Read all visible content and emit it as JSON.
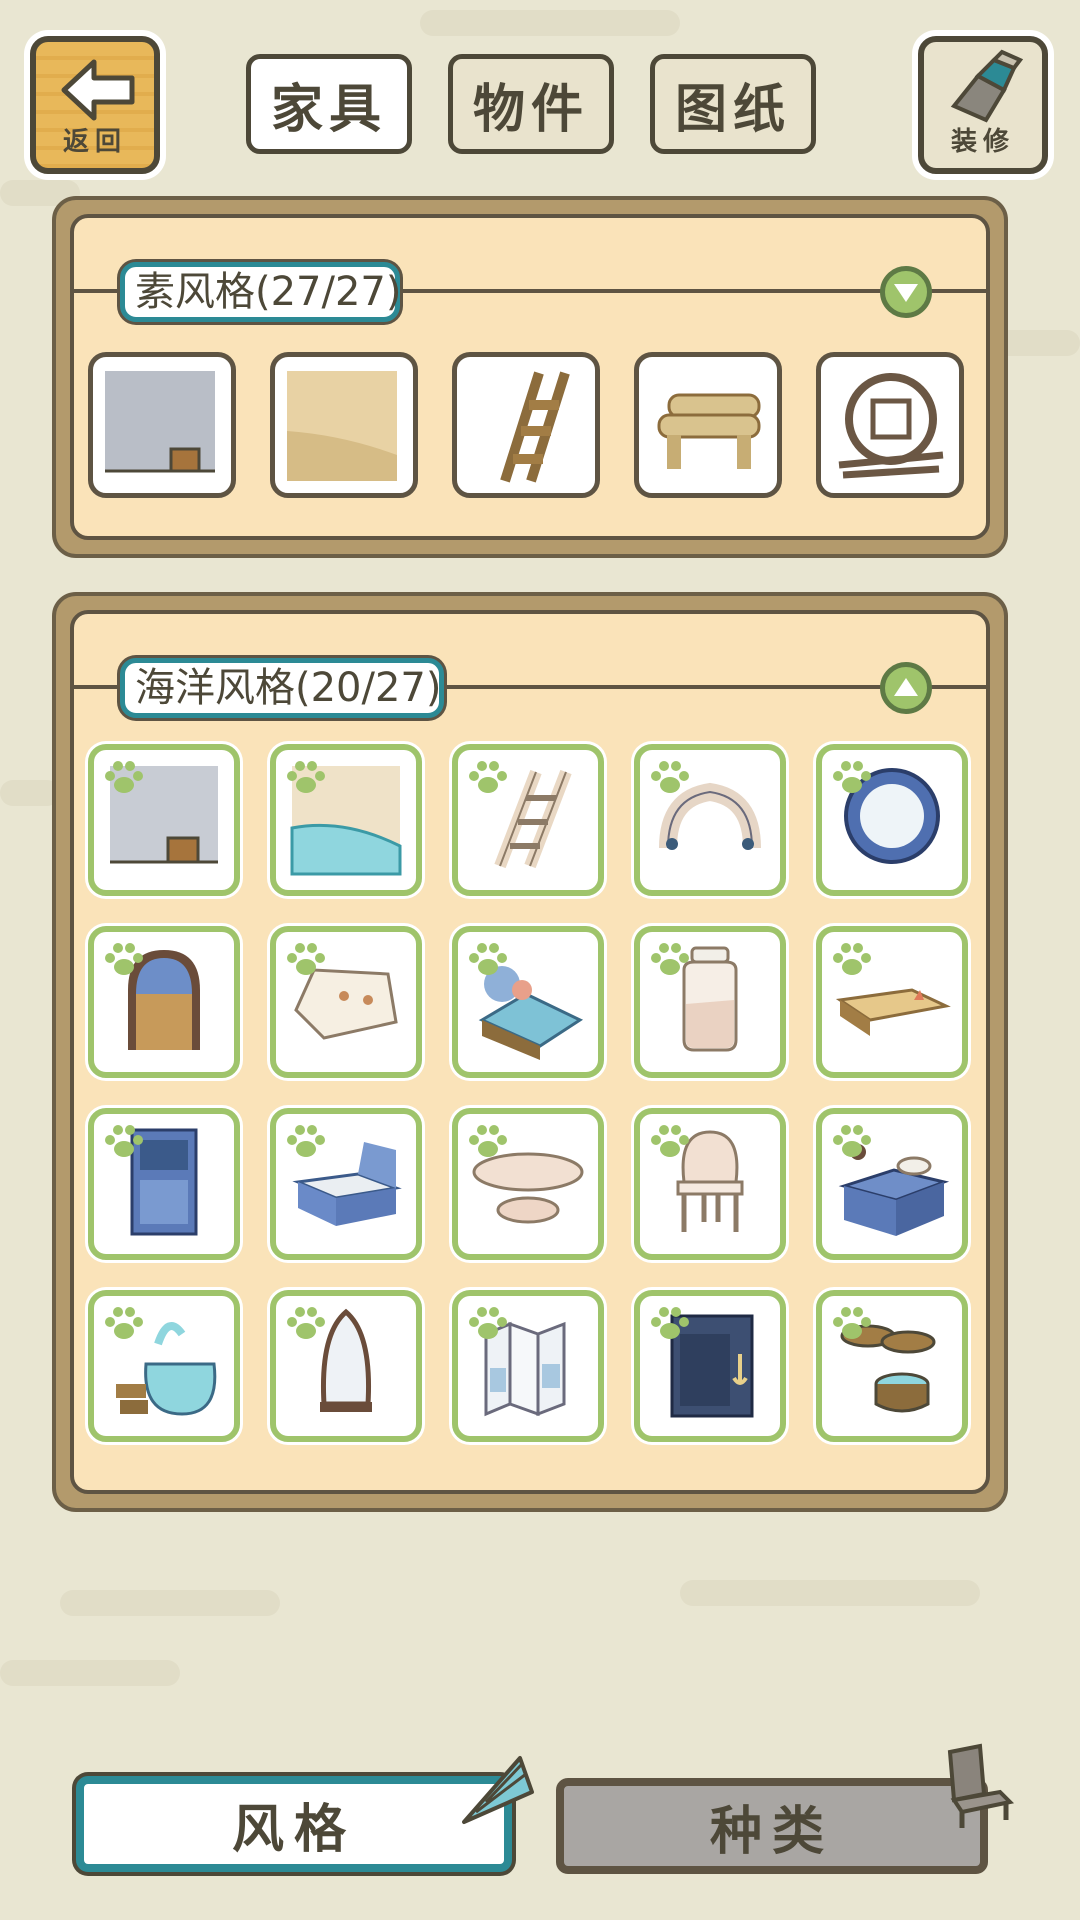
{
  "top_tabs": [
    "家具",
    "物件",
    "图纸"
  ],
  "back_label": "返回",
  "decorate_label": "装修",
  "sections": [
    {
      "title": "素风格(27/27)",
      "expanded": false,
      "items": [
        "stone-wall",
        "sand-floor",
        "wood-ladder",
        "log-bench",
        "round-window-frame"
      ]
    },
    {
      "title": "海洋风格(20/27)",
      "expanded": true,
      "items": [
        "ocean-wall",
        "pool-floor",
        "white-ladder",
        "tooth-rocks",
        "porthole-window",
        "arched-door",
        "map-rug",
        "shell-bed",
        "sand-jar",
        "starfish-bench",
        "blue-cabinet",
        "open-chest",
        "clam-table",
        "shell-chair",
        "kitchen-counter",
        "fountain-tub",
        "surfboard-mirror",
        "folding-screen",
        "anchor-cabinet",
        "barrel-stack"
      ]
    }
  ],
  "bottom_tabs": {
    "style": "风格",
    "kind": "种类"
  },
  "colors": {
    "accent": "#2c8a95",
    "paw": "#9fc46b",
    "panel": "#fae3b9",
    "outline": "#4d4838"
  }
}
